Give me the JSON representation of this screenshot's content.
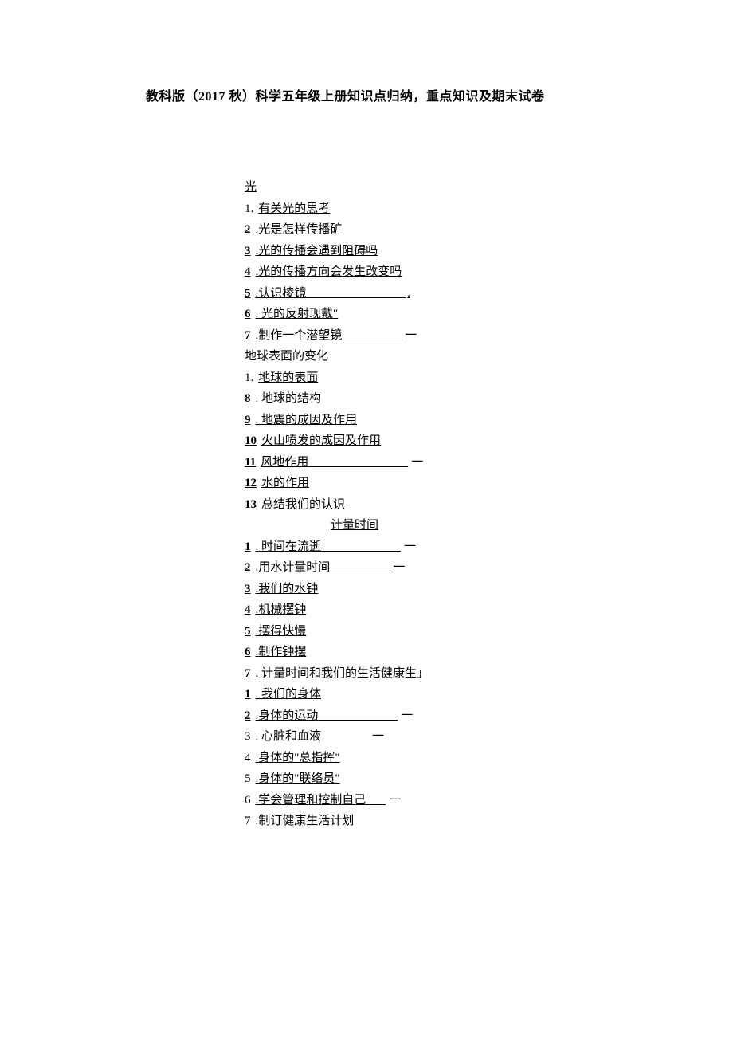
{
  "title": "教科版（2017 秋）科学五年级上册知识点归纳，重点知识及期末试卷",
  "sections": {
    "unit1": {
      "header": "光",
      "items": [
        {
          "num": "1.",
          "text": "有关光的思考",
          "numBold": false
        },
        {
          "num": "2",
          "text": ".光是怎样传播矿",
          "numBold": true
        },
        {
          "num": "3",
          "text": ".光的传播会遇到阻碍吗",
          "numBold": true
        },
        {
          "num": "4",
          "text": ".光的传播方向会发生改变吗",
          "numBold": true
        },
        {
          "num": "5",
          "text": ".认识棱镜",
          "numBold": true,
          "trailingBlank": "　　　　　",
          "trailingDot": "."
        },
        {
          "num": "6",
          "text": ". 光的反射现戴″",
          "numBold": true
        },
        {
          "num": "7",
          "text": ".制作一个潜望镜",
          "numBold": true,
          "trailingBlank": "　　　",
          "trailingDash": "一"
        }
      ]
    },
    "unit2": {
      "header": "地球表面的变化",
      "items": [
        {
          "num": "1.",
          "text": "地球的表面",
          "numBold": false
        },
        {
          "num": "8",
          "text": ". 地球的结构",
          "numBold": true,
          "noUnderlineText": true
        },
        {
          "num": "9",
          "text": ". 地震的成因及作用",
          "numBold": true
        },
        {
          "num": "10",
          "text": "火山喷发的成因及作用",
          "numBold": true
        },
        {
          "num": "11",
          "text": "风地作用",
          "numBold": true,
          "trailingBlank": "　　　　　",
          "trailingDash": "一"
        },
        {
          "num": "12",
          "text": "水的作用",
          "numBold": true
        },
        {
          "num": "13",
          "text": "总结我们的认识",
          "numBold": true
        }
      ]
    },
    "unit3": {
      "header": "计量时间",
      "headerIndent": true,
      "items": [
        {
          "num": "1",
          "text": ". 时间在流逝",
          "numBold": true,
          "trailingBlank": "　　　　",
          "trailingDash": "一"
        },
        {
          "num": "2",
          "text": ".用水计量时间",
          "numBold": true,
          "trailingBlank": "　　　",
          "trailingDash": "一"
        },
        {
          "num": "3",
          "text": ".我们的水钟",
          "numBold": true
        },
        {
          "num": "4",
          "text": ".机械摆钟",
          "numBold": true
        },
        {
          "num": "5",
          "text": ".摆得快慢",
          "numBold": true
        },
        {
          "num": "6",
          "text": ".制作钟摆",
          "numBold": true
        },
        {
          "num": "7",
          "text": ". 计量时间和我们的生活",
          "numBold": true,
          "appendPlain": "健康生」"
        }
      ]
    },
    "unit4": {
      "items": [
        {
          "num": "1",
          "text": ". 我们的身体",
          "numBold": true
        },
        {
          "num": "2",
          "text": ".身体的运动",
          "numBold": true,
          "trailingBlank": "　　　　",
          "trailingDash": "一"
        },
        {
          "num": "3",
          "text": ". 心脏和血液",
          "numBold": false,
          "noUnderlineText": true,
          "trailingBlank": "　　　　",
          "trailingDash": "一"
        },
        {
          "num": "4",
          "text": ".身体的\"总指挥\"",
          "numBold": false
        },
        {
          "num": "5",
          "text": ".身体的\"联络员\"",
          "numBold": false
        },
        {
          "num": "6",
          "text": ".学会管理和控制自己",
          "numBold": false,
          "trailingBlank": "　",
          "trailingDash": "一"
        },
        {
          "num": "7",
          "text": ".制订健康生活计划",
          "numBold": false,
          "noUnderlineText": true
        }
      ]
    }
  }
}
